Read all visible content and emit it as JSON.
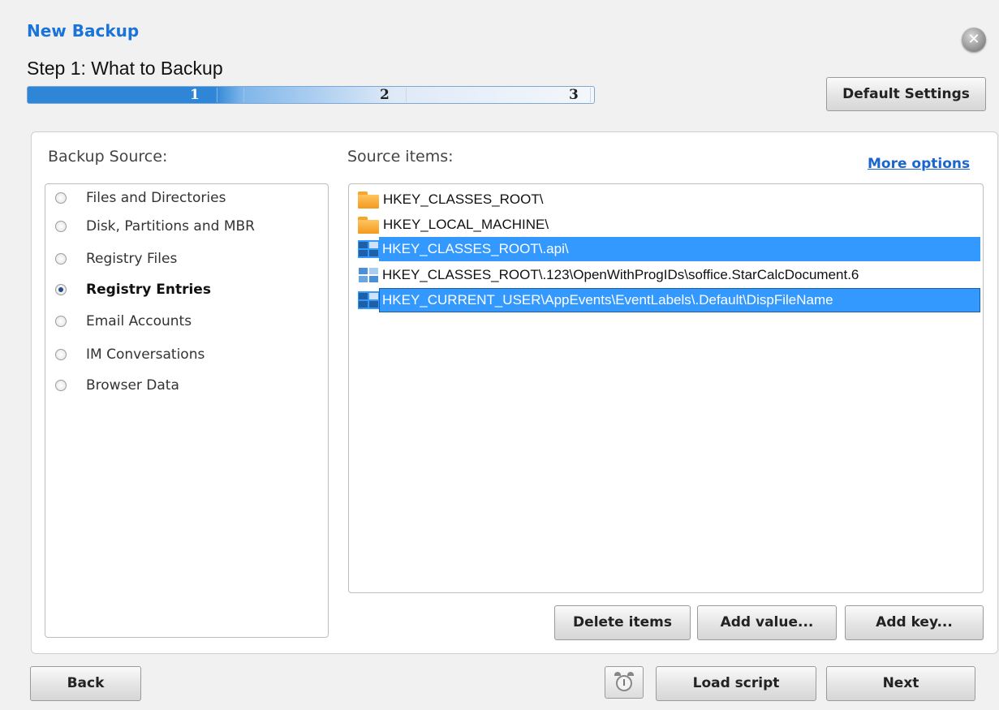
{
  "window": {
    "title": "New Backup",
    "step_title": "Step 1: What to Backup",
    "close_glyph": "✕"
  },
  "progress": {
    "steps": [
      "1",
      "2",
      "3"
    ],
    "current_step": 1
  },
  "header": {
    "default_settings_label": "Default Settings"
  },
  "source": {
    "label": "Backup Source:",
    "options": [
      {
        "label": "Files and Directories",
        "checked": false
      },
      {
        "label": "Disk, Partitions and MBR",
        "checked": false
      },
      {
        "label": "Registry Files",
        "checked": false
      },
      {
        "label": "Registry Entries",
        "checked": true
      },
      {
        "label": "Email Accounts",
        "checked": false
      },
      {
        "label": "IM Conversations",
        "checked": false
      },
      {
        "label": "Browser Data",
        "checked": false
      }
    ]
  },
  "items": {
    "label": "Source items:",
    "more_options": "More options",
    "list": [
      {
        "icon": "folder-icon",
        "text": "HKEY_CLASSES_ROOT\\",
        "highlighted": false
      },
      {
        "icon": "folder-icon",
        "text": "HKEY_LOCAL_MACHINE\\",
        "highlighted": false
      },
      {
        "icon": "registry-value-icon",
        "text": "HKEY_CLASSES_ROOT\\.api\\",
        "highlighted": true
      },
      {
        "icon": "registry-value-icon",
        "text": "HKEY_CLASSES_ROOT\\.123\\OpenWithProgIDs\\soffice.StarCalcDocument.6",
        "highlighted": false
      },
      {
        "icon": "registry-value-icon",
        "text": "HKEY_CURRENT_USER\\AppEvents\\EventLabels\\.Default\\DispFileName",
        "highlighted": true
      }
    ],
    "delete_label": "Delete items",
    "add_value_label": "Add value...",
    "add_key_label": "Add key..."
  },
  "footer": {
    "back_label": "Back",
    "load_script_label": "Load script",
    "next_label": "Next"
  },
  "colors": {
    "accent": "#1a73d9",
    "selection": "#3399ff"
  }
}
